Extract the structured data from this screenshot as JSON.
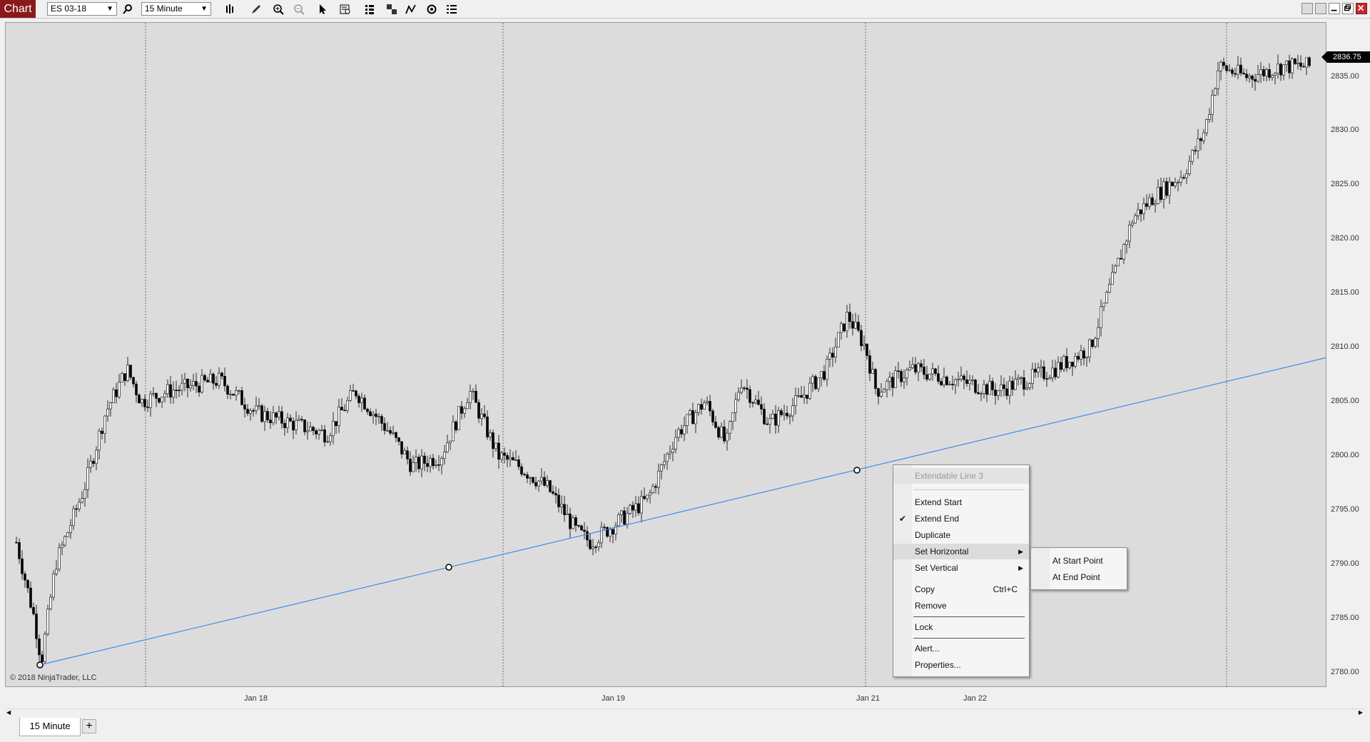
{
  "toolbar": {
    "app_badge": "Chart",
    "instrument": "ES 03-18",
    "interval": "15 Minute",
    "icons": [
      "search-icon",
      "bar-type-icon",
      "pencil-icon",
      "zoom-in-icon",
      "zoom-out-icon",
      "pointer-icon",
      "data-box-icon",
      "chart-trader-icon",
      "templates-icon",
      "strategies-icon",
      "indicators-icon",
      "properties-icon"
    ]
  },
  "price_axis": {
    "ticks": [
      "2835.00",
      "2830.00",
      "2825.00",
      "2820.00",
      "2815.00",
      "2810.00",
      "2805.00",
      "2800.00",
      "2795.00",
      "2790.00",
      "2785.00",
      "2780.00"
    ],
    "last_price": "2836.75"
  },
  "time_axis": {
    "labels": [
      "Jan 18",
      "Jan 19",
      "Jan 21",
      "Jan 22"
    ]
  },
  "copyright": "© 2018 NinjaTrader, LLC",
  "tabs": {
    "active": "15 Minute",
    "add": "+"
  },
  "context_menu": {
    "title": "Extendable Line 3",
    "items": {
      "extend_start": "Extend Start",
      "extend_end": "Extend End",
      "duplicate": "Duplicate",
      "set_horizontal": "Set Horizontal",
      "set_vertical": "Set Vertical",
      "copy": "Copy",
      "copy_shortcut": "Ctrl+C",
      "remove": "Remove",
      "lock": "Lock",
      "alert": "Alert...",
      "properties": "Properties..."
    },
    "checked": "Extend End"
  },
  "submenu": {
    "at_start_point": "At Start Point",
    "at_end_point": "At End Point"
  },
  "colors": {
    "chart_bg": "#dcdcdc",
    "trend_line": "#3d8ee6",
    "candle": "#000000",
    "badge": "#8a1a1a"
  }
}
